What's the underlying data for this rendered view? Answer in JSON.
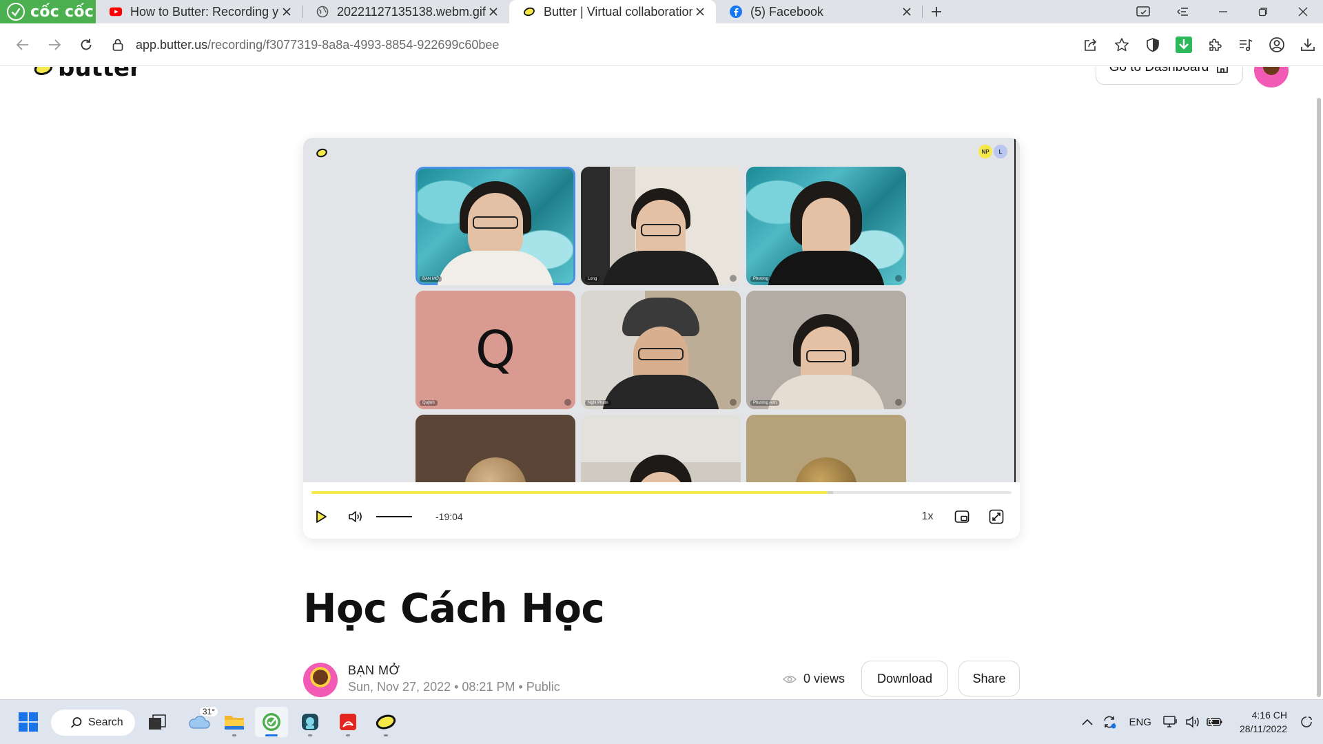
{
  "browser": {
    "brand": "cốc cốc",
    "tabs": [
      {
        "title": "How to Butter: Recording yo",
        "icon": "youtube-icon"
      },
      {
        "title": "20221127135138.webm.gif (",
        "icon": "globe-icon"
      },
      {
        "title": "Butter | Virtual collaboration",
        "icon": "butter-icon",
        "active": true
      },
      {
        "title": "(5) Facebook",
        "icon": "facebook-icon"
      }
    ],
    "url_host": "app.butter.us",
    "url_path": "/recording/f3077319-8a8a-4993-8854-922699c60bee"
  },
  "header": {
    "logo_text": "butter",
    "dashboard_label": "Go to Dashboard"
  },
  "player": {
    "participant_badges": [
      "NP",
      "L"
    ],
    "tiles": [
      {
        "name": "BẠN MỞ",
        "kind": "person",
        "variant": "swirl-glasses"
      },
      {
        "name": "Long",
        "kind": "person",
        "variant": "room"
      },
      {
        "name": "Phương",
        "kind": "person",
        "variant": "swirl"
      },
      {
        "name": "Quỳnh",
        "kind": "letter",
        "letter": "Q"
      },
      {
        "name": "Nghi Phạm",
        "kind": "person",
        "variant": "cap"
      },
      {
        "name": "Phương Anh",
        "kind": "person",
        "variant": "wall"
      },
      {
        "name": "",
        "kind": "bust",
        "variant": "dark"
      },
      {
        "name": "",
        "kind": "person",
        "variant": "room2"
      },
      {
        "name": "",
        "kind": "bust",
        "variant": "gold"
      }
    ],
    "progress": 0.737,
    "buffered_to": 0.745,
    "volume": 1.0,
    "time_remaining": "-19:04",
    "speed": "1x"
  },
  "recording": {
    "title": "Học Cách Học",
    "author": "BẠN MỞ",
    "meta": "Sun, Nov 27, 2022 • 08:21 PM • Public",
    "views": "0 views",
    "download_label": "Download",
    "share_label": "Share"
  },
  "taskbar": {
    "search_label": "Search",
    "weather": "31°",
    "language": "ENG",
    "time": "4:16 CH",
    "date": "28/11/2022"
  },
  "colors": {
    "brand_green": "#4caf50",
    "progress_yellow": "#f5e94a",
    "tab_strip": "#dfe3e8"
  }
}
